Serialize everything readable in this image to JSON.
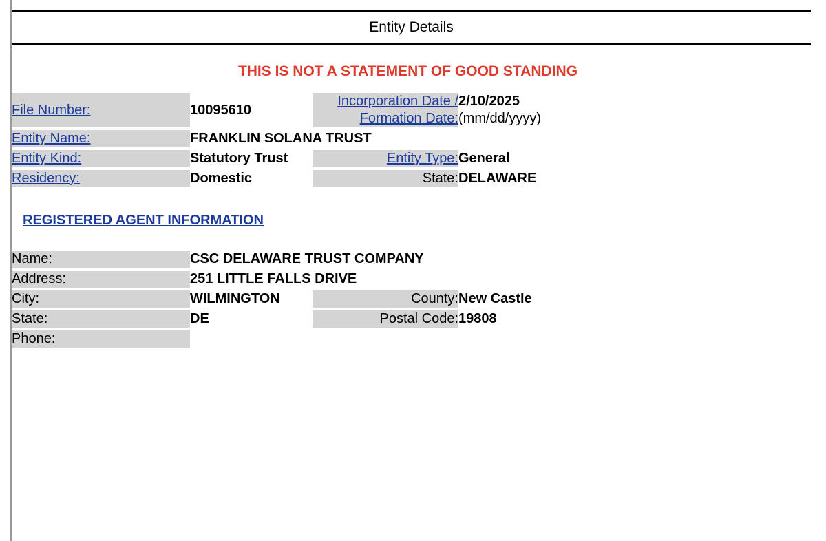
{
  "header": {
    "title": "Entity Details"
  },
  "warning": "THIS IS NOT A STATEMENT OF GOOD STANDING",
  "colors": {
    "link": "#1b3a9c",
    "warning": "#e0392b",
    "label_background": "#d4d4d4"
  },
  "entity": {
    "rows": [
      {
        "label1": "File Number:",
        "value1": "10095610",
        "label2": "Incorporation Date / Formation Date:",
        "value2": "2/10/2025",
        "value2_sub": "(mm/dd/yyyy)"
      },
      {
        "label1": "Entity Name:",
        "value1": "FRANKLIN SOLANA TRUST",
        "label2": "",
        "value2": "",
        "value2_sub": ""
      },
      {
        "label1": "Entity Kind:",
        "value1": "Statutory Trust",
        "label2": "Entity Type:",
        "value2": "General",
        "value2_sub": ""
      },
      {
        "label1": "Residency:",
        "value1": "Domestic",
        "label2": "State:",
        "value2": "DELAWARE",
        "value2_sub": ""
      }
    ]
  },
  "registered_agent": {
    "heading": "REGISTERED AGENT INFORMATION",
    "rows": [
      {
        "label1": "Name:",
        "value1": "CSC DELAWARE TRUST COMPANY",
        "label2": "",
        "value2": ""
      },
      {
        "label1": "Address:",
        "value1": "251 LITTLE FALLS DRIVE",
        "label2": "",
        "value2": ""
      },
      {
        "label1": "City:",
        "value1": "WILMINGTON",
        "label2": "County:",
        "value2": "New Castle"
      },
      {
        "label1": "State:",
        "value1": "DE",
        "label2": "Postal Code:",
        "value2": "19808"
      },
      {
        "label1": "Phone:",
        "value1": "",
        "label2": "",
        "value2": ""
      }
    ]
  }
}
